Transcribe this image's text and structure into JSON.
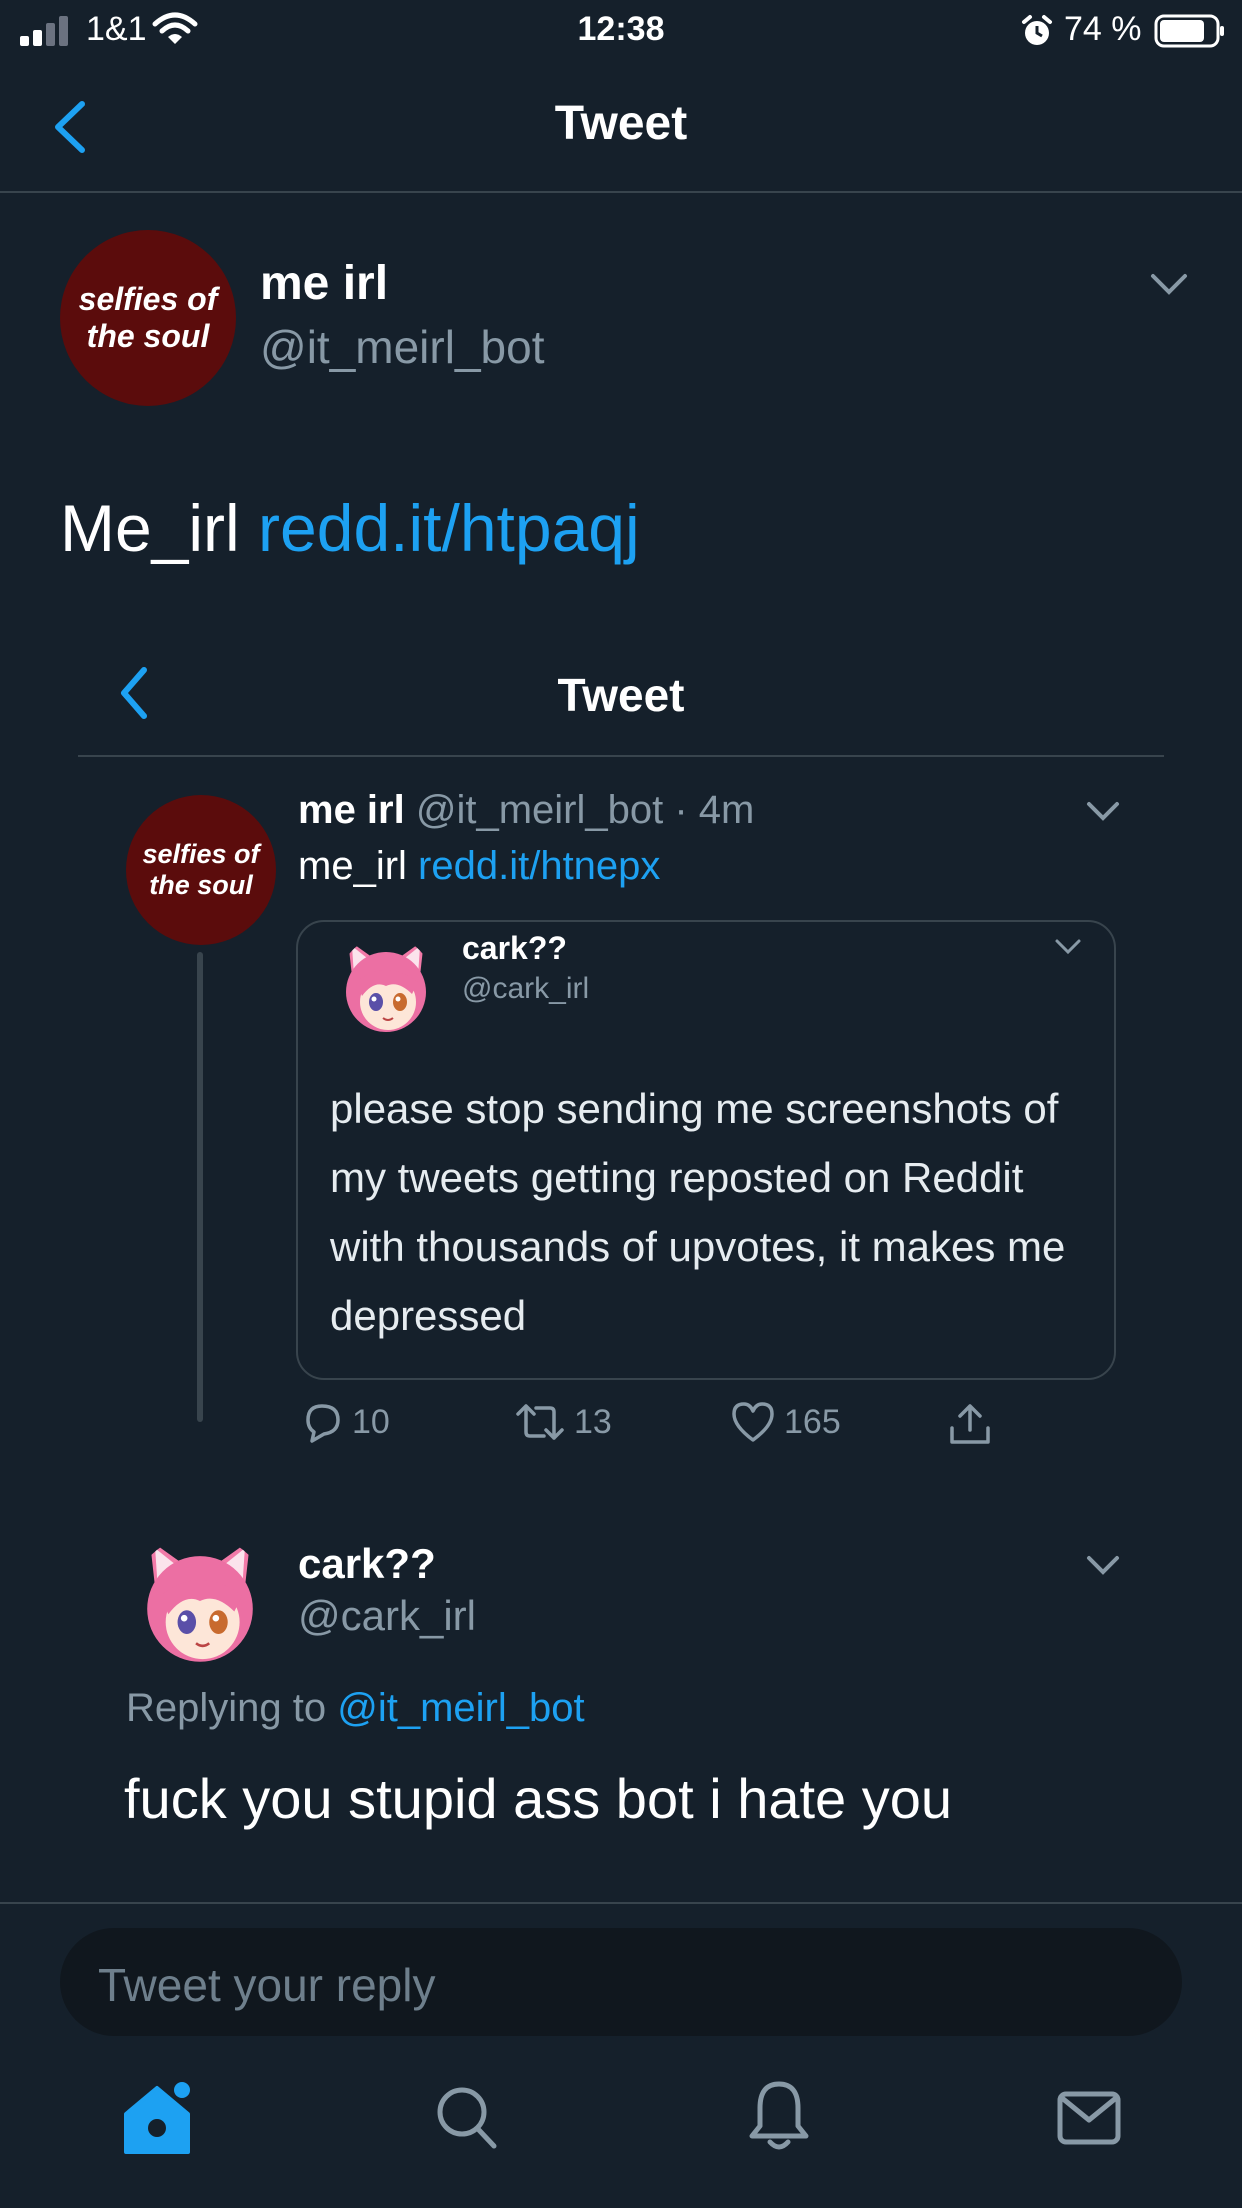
{
  "status_bar": {
    "carrier": "1&1",
    "time": "12:38",
    "battery_percent": "74 %"
  },
  "header": {
    "title": "Tweet"
  },
  "main_tweet": {
    "display_name": "me irl",
    "handle": "@it_meirl_bot",
    "avatar_text": "selfies of the soul",
    "text_plain": "Me_irl",
    "text_link": "redd.it/htpaqj"
  },
  "screenshot": {
    "header_title": "Tweet",
    "bot_tweet": {
      "display_name": "me irl",
      "handle_time": "@it_meirl_bot · 4m",
      "avatar_text": "selfies of the soul",
      "text_plain": "me_irl",
      "text_link": "redd.it/htnepx",
      "quoted": {
        "display_name": "cark??",
        "handle": "@cark_irl",
        "text": "please stop sending me screenshots of my tweets getting reposted on Reddit with thousands of upvotes, it makes me depressed"
      },
      "actions": {
        "replies": "10",
        "retweets": "13",
        "likes": "165"
      }
    },
    "reply_tweet": {
      "display_name": "cark??",
      "handle": "@cark_irl",
      "replying_prefix": "Replying to",
      "replying_to": "@it_meirl_bot",
      "text": "fuck you stupid ass bot i hate you"
    }
  },
  "reply_box": {
    "placeholder": "Tweet your reply"
  },
  "tab_bar": {
    "items": [
      "home-icon",
      "search-icon",
      "notifications-icon",
      "messages-icon"
    ],
    "active_color": "#1da1f2"
  },
  "colors": {
    "background": "#15202b",
    "accent": "#1da1f2",
    "muted": "#8899a6",
    "divider": "#38444d"
  }
}
